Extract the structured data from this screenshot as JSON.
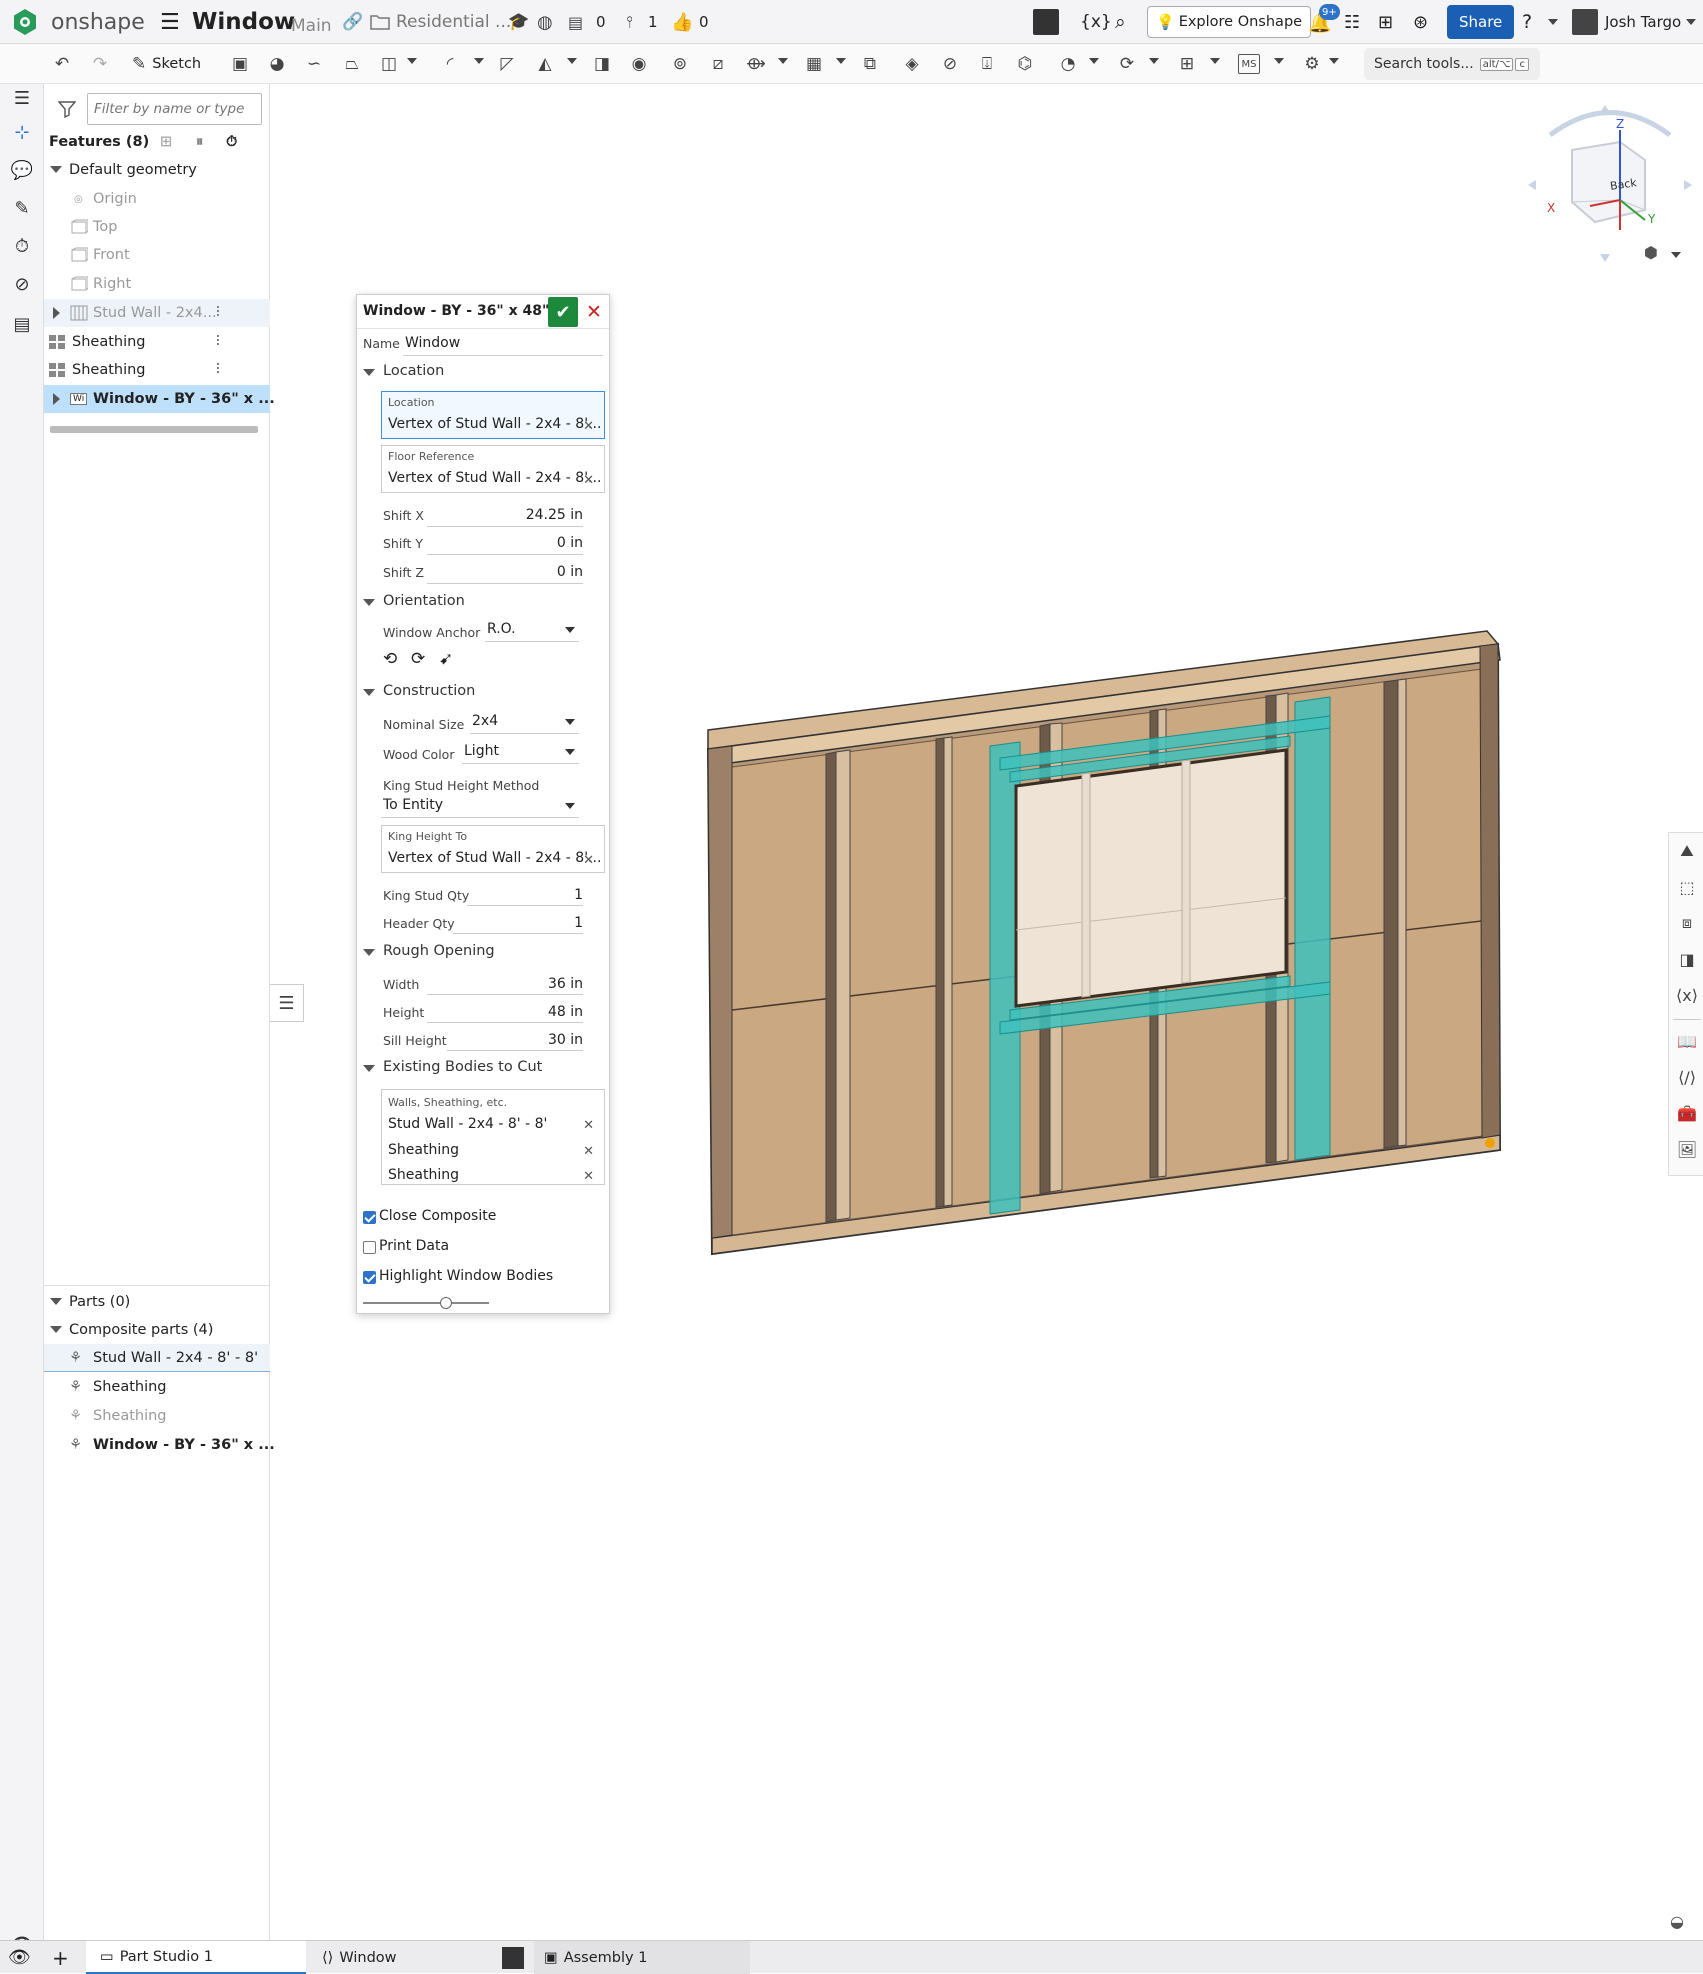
{
  "topbar": {
    "brand": "onshape",
    "doc_title": "Window",
    "branch": "Main",
    "folder": "Residential ...",
    "versions_count": "0",
    "branches_count": "1",
    "likes_count": "0",
    "explore_label": "Explore Onshape",
    "notif_badge": "9+",
    "share_label": "Share",
    "user_name": "Josh Targo"
  },
  "toolbar": {
    "sketch_label": "Sketch",
    "ms_label": "MS",
    "search_label": "Search tools...",
    "search_shortcut_1": "alt/⌥",
    "search_shortcut_2": "c"
  },
  "feature_panel": {
    "filter_placeholder": "Filter by name or type",
    "features_header": "Features (8)",
    "default_geometry": "Default geometry",
    "origin": "Origin",
    "planes": [
      "Top",
      "Front",
      "Right"
    ],
    "features": [
      "Stud Wall - 2x4...",
      "Sheathing",
      "Sheathing",
      "Window - BY - 36\" x ..."
    ],
    "window_badge": "Wi",
    "parts_header": "Parts (0)",
    "composite_header": "Composite parts (4)",
    "composite_parts": [
      "Stud Wall - 2x4 - 8' - 8'",
      "Sheathing",
      "Sheathing",
      "Window - BY - 36\" x ..."
    ]
  },
  "dialog": {
    "title": "Window - BY - 36\" x 48\"",
    "name_label": "Name",
    "name_value": "Window",
    "location_section": "Location",
    "location_label": "Location",
    "location_value": "Vertex of Stud Wall - 2x4 - 8'...",
    "floor_ref_label": "Floor Reference",
    "floor_ref_value": "Vertex of Stud Wall - 2x4 - 8'...",
    "shift_x_label": "Shift X",
    "shift_x_value": "24.25 in",
    "shift_y_label": "Shift Y",
    "shift_y_value": "0 in",
    "shift_z_label": "Shift Z",
    "shift_z_value": "0 in",
    "orientation_section": "Orientation",
    "anchor_label": "Window Anchor",
    "anchor_value": "R.O.",
    "construction_section": "Construction",
    "nominal_label": "Nominal Size",
    "nominal_value": "2x4",
    "wood_label": "Wood Color",
    "wood_value": "Light",
    "king_method_label": "King Stud Height Method",
    "king_method_value": "To Entity",
    "king_height_label": "King Height To",
    "king_height_value": "Vertex of Stud Wall - 2x4 - 8'...",
    "king_qty_label": "King Stud Qty",
    "king_qty_value": "1",
    "header_qty_label": "Header Qty",
    "header_qty_value": "1",
    "rough_section": "Rough Opening",
    "width_label": "Width",
    "width_value": "36 in",
    "height_label": "Height",
    "height_value": "48 in",
    "sill_label": "Sill Height",
    "sill_value": "30 in",
    "cut_section": "Existing Bodies to Cut",
    "cut_box_label": "Walls, Sheathing, etc.",
    "cut_items": [
      "Stud Wall - 2x4 - 8' - 8'",
      "Sheathing",
      "Sheathing"
    ],
    "close_composite": "Close Composite",
    "print_data": "Print Data",
    "highlight": "Highlight Window Bodies",
    "slider_value": 0.66
  },
  "viewcube": {
    "face": "Back",
    "z": "Z",
    "x": "X",
    "y": "Y"
  },
  "bottom_tabs": [
    "Part Studio 1",
    "Window",
    "Assembly 1"
  ],
  "colors": {
    "accent": "#2e73c8",
    "share": "#1a5fb4",
    "teal": "#2cb8b4",
    "wood": "#c8a47e"
  }
}
